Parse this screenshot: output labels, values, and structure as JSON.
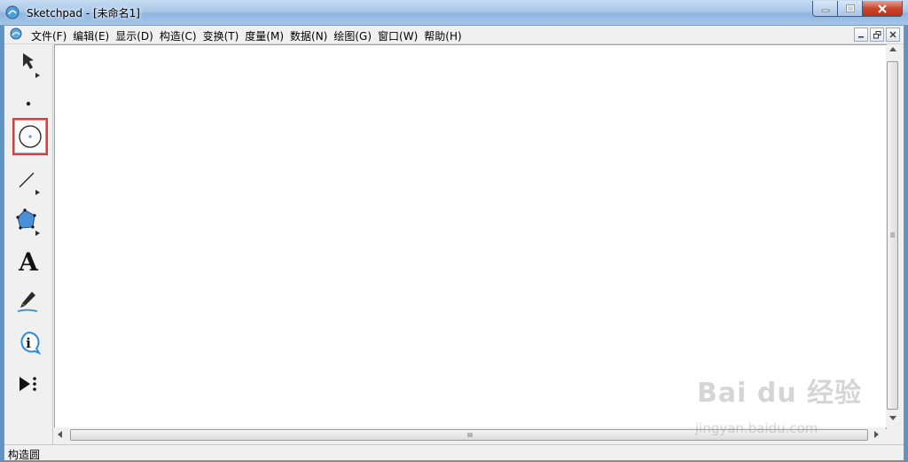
{
  "window": {
    "title": "Sketchpad  - [未命名1]"
  },
  "menu": {
    "items": [
      {
        "label": "文件(F)"
      },
      {
        "label": "编辑(E)"
      },
      {
        "label": "显示(D)"
      },
      {
        "label": "构造(C)"
      },
      {
        "label": "变换(T)"
      },
      {
        "label": "度量(M)"
      },
      {
        "label": "数据(N)"
      },
      {
        "label": "绘图(G)"
      },
      {
        "label": "窗口(W)"
      },
      {
        "label": "帮助(H)"
      }
    ]
  },
  "toolbox": {
    "tools": [
      {
        "name": "arrow-tool",
        "icon": "arrow-select-icon"
      },
      {
        "name": "point-tool",
        "icon": "point-icon"
      },
      {
        "name": "compass-tool",
        "icon": "circle-compass-icon",
        "selected": true
      },
      {
        "name": "straightedge-tool",
        "icon": "line-segment-icon"
      },
      {
        "name": "polygon-tool",
        "icon": "polygon-icon"
      },
      {
        "name": "text-tool",
        "icon": "text-A-icon",
        "glyph": "A"
      },
      {
        "name": "marker-tool",
        "icon": "marker-pen-icon"
      },
      {
        "name": "information-tool",
        "icon": "info-icon",
        "glyph": "i"
      },
      {
        "name": "custom-tool",
        "icon": "custom-tool-icon"
      }
    ]
  },
  "statusbar": {
    "text": "构造圆"
  },
  "watermark": {
    "brand": "Bai du 经验",
    "url": "jingyan.baidu.com"
  },
  "colors": {
    "selection_border": "#e03a3a",
    "polygon_fill": "#4a90d9",
    "titlebar": "#a9c7e8"
  }
}
